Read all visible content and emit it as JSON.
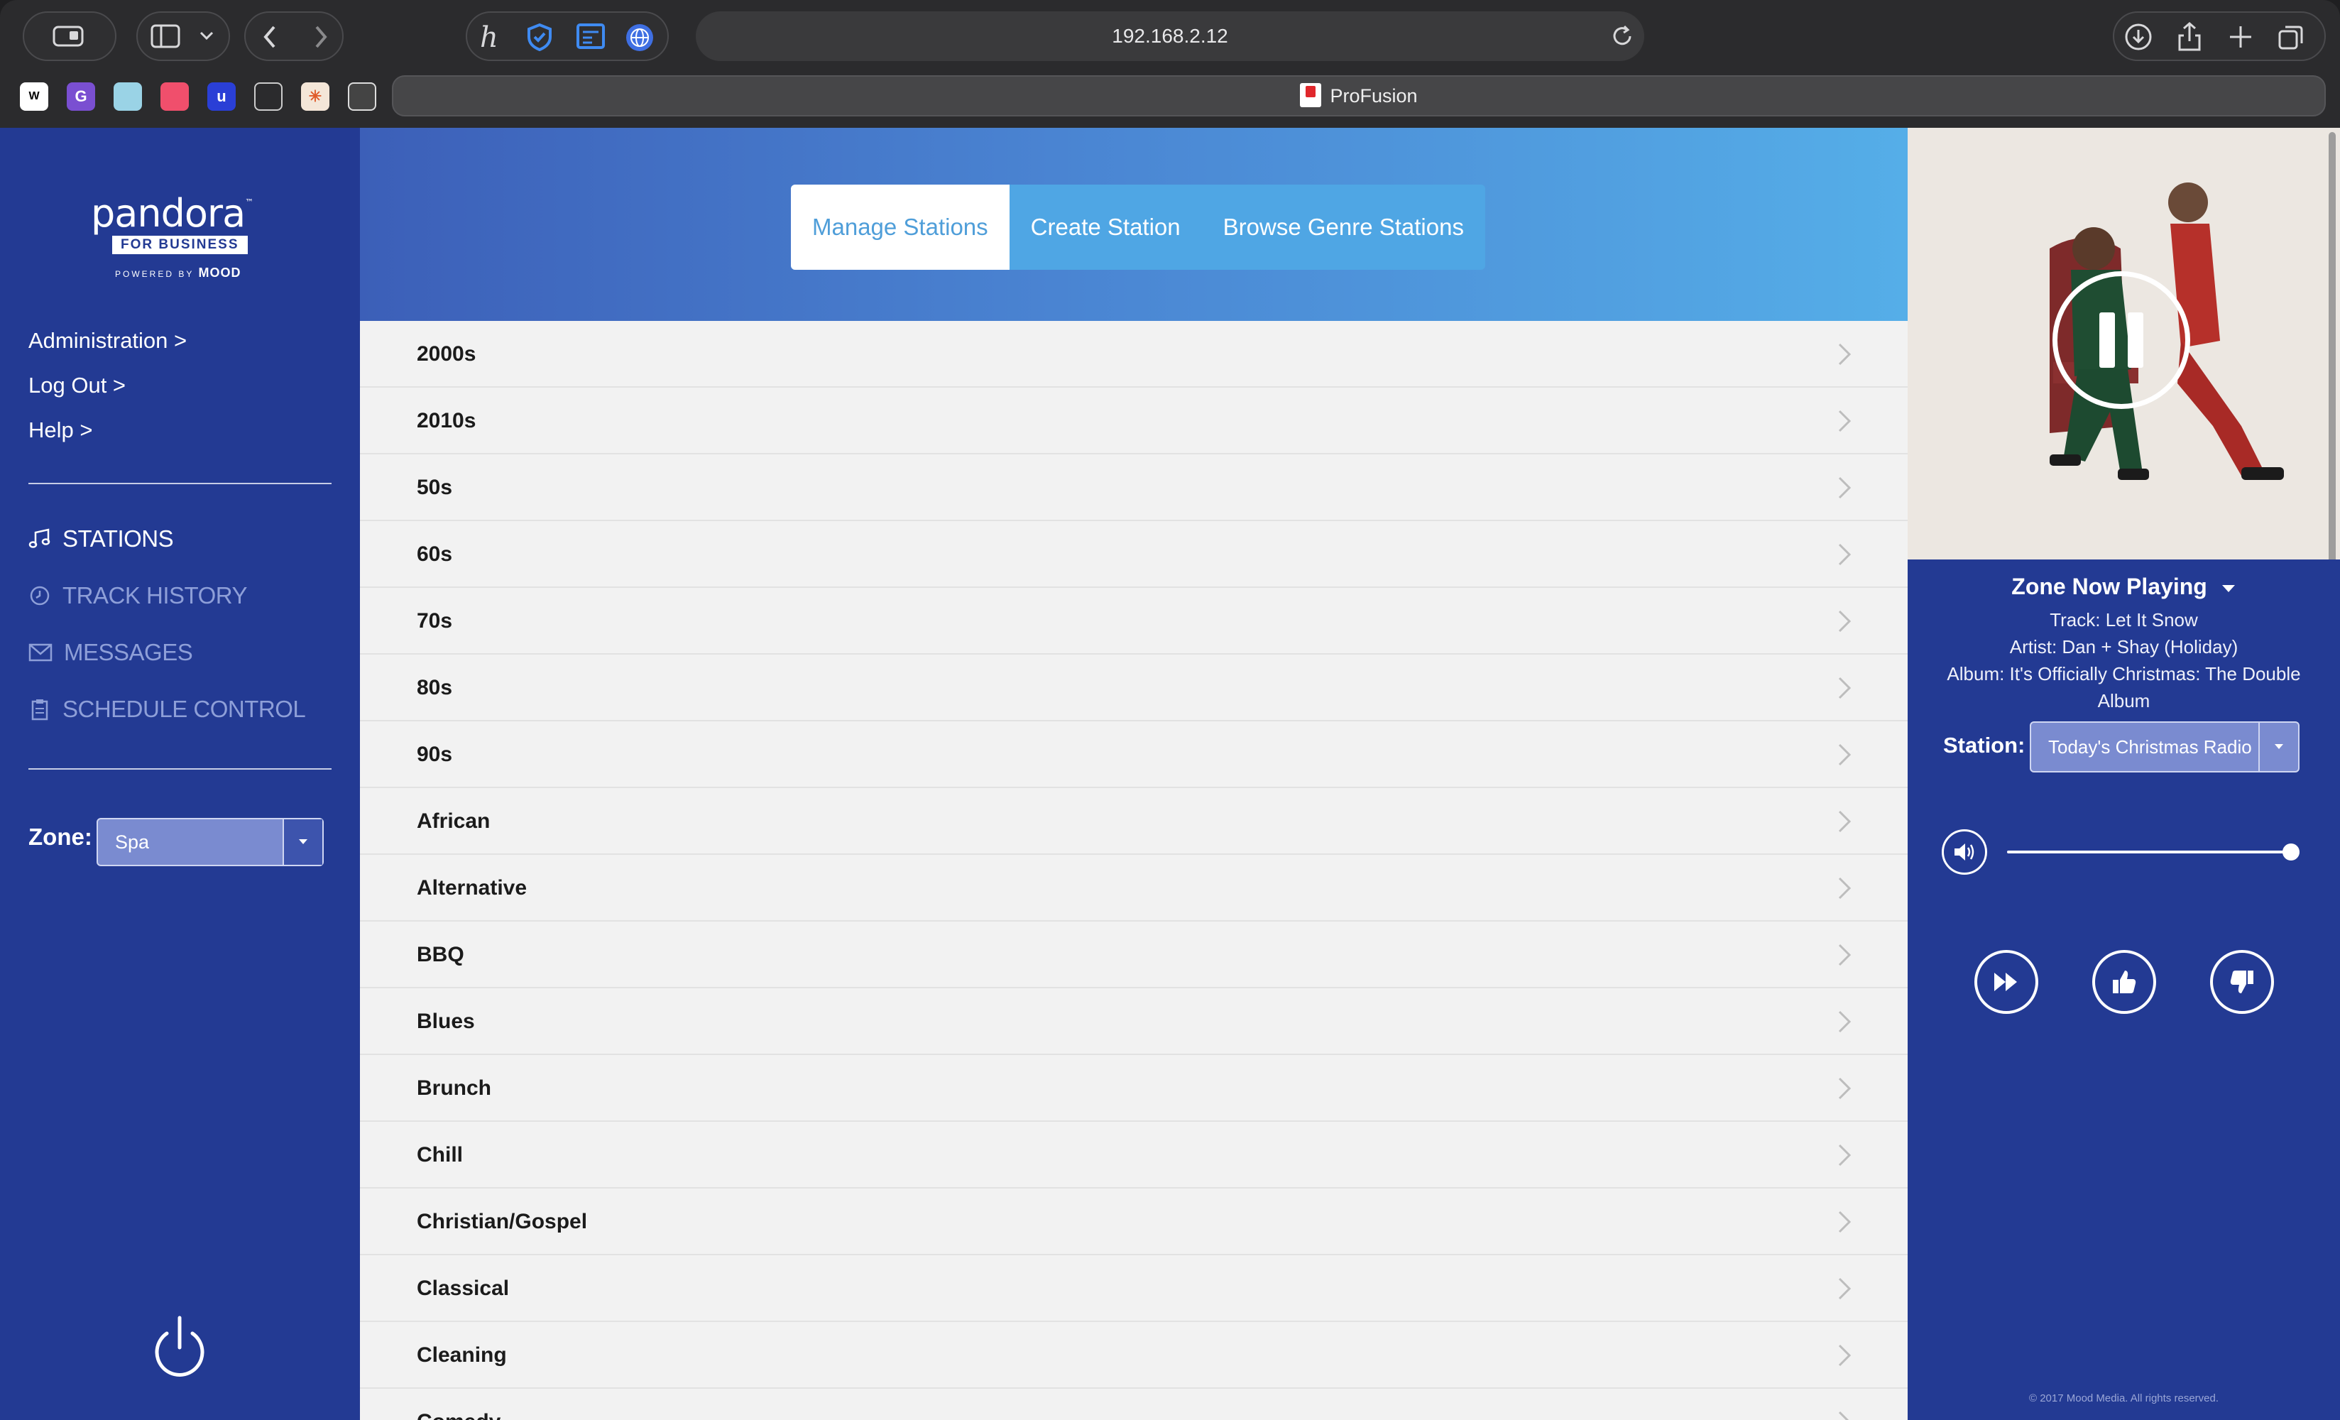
{
  "browser": {
    "address": "192.168.2.12",
    "tab_title": "ProFusion"
  },
  "brand": {
    "wordmark": "pandora",
    "tm": "™",
    "tagline": "FOR BUSINESS",
    "powered_by": "POWERED BY",
    "powered_brand": "MOOD"
  },
  "sidebar": {
    "links": [
      "Administration >",
      "Log Out >",
      "Help >"
    ],
    "nav": [
      {
        "label": "STATIONS",
        "icon": "music-note-icon"
      },
      {
        "label": "TRACK HISTORY",
        "icon": "clock-icon"
      },
      {
        "label": "MESSAGES",
        "icon": "envelope-icon"
      },
      {
        "label": "SCHEDULE CONTROL",
        "icon": "clipboard-icon"
      }
    ],
    "zone_label": "Zone:",
    "zone_value": "Spa"
  },
  "tabs": [
    "Manage Stations",
    "Create Station",
    "Browse Genre Stations"
  ],
  "genres": [
    "2000s",
    "2010s",
    "50s",
    "60s",
    "70s",
    "80s",
    "90s",
    "African",
    "Alternative",
    "BBQ",
    "Blues",
    "Brunch",
    "Chill",
    "Christian/Gospel",
    "Classical",
    "Cleaning",
    "Comedy"
  ],
  "now_playing": {
    "title": "Zone Now Playing",
    "track": "Track: Let It Snow",
    "artist": "Artist: Dan + Shay (Holiday)",
    "album_line1": "Album: It's Officially Christmas: The Double",
    "album_line2": "Album",
    "station_label": "Station:",
    "station_value": "Today's Christmas Radio",
    "volume_percent": 100,
    "copyright": "© 2017 Mood Media. All rights reserved."
  },
  "colors": {
    "sidebar": "#233a93",
    "accent": "#4f9ed9",
    "list_bg": "#f2f2f2"
  }
}
